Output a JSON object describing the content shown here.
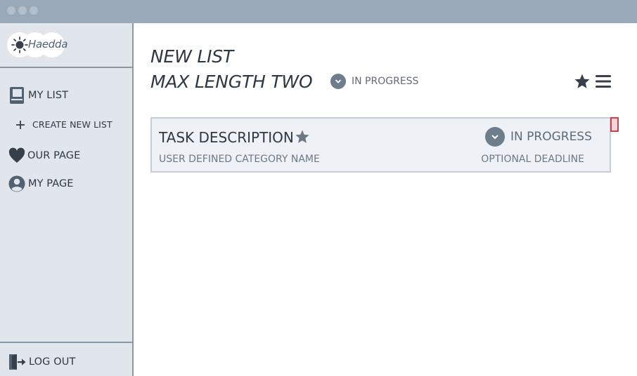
{
  "app": {
    "logo_text": "Haedda"
  },
  "sidebar": {
    "items": [
      {
        "label": "MY LIST",
        "icon": "book-icon"
      },
      {
        "label": "CREATE NEW LIST",
        "icon": "plus-icon"
      },
      {
        "label": "OUR PAGE",
        "icon": "heart-icon"
      },
      {
        "label": "MY PAGE",
        "icon": "user-avatar-icon"
      }
    ],
    "logout": {
      "label": "LOG OUT",
      "icon": "door-exit-icon"
    }
  },
  "list": {
    "title_line1": "NEW LIST",
    "title_line2": "MAX LENGTH TWO",
    "status": "IN PROGRESS"
  },
  "task": {
    "title": "TASK DESCRIPTION",
    "category": "USER DEFINED CATEGORY NAME",
    "status": "IN PROGRESS",
    "deadline": "OPTIONAL DEADLINE"
  },
  "colors": {
    "titlebar": "#9aa9b7",
    "sidebar_bg": "#e1e5ec",
    "icon": "#4f6274",
    "card_bg": "#eef2f6",
    "handle_border": "#c9424d"
  }
}
